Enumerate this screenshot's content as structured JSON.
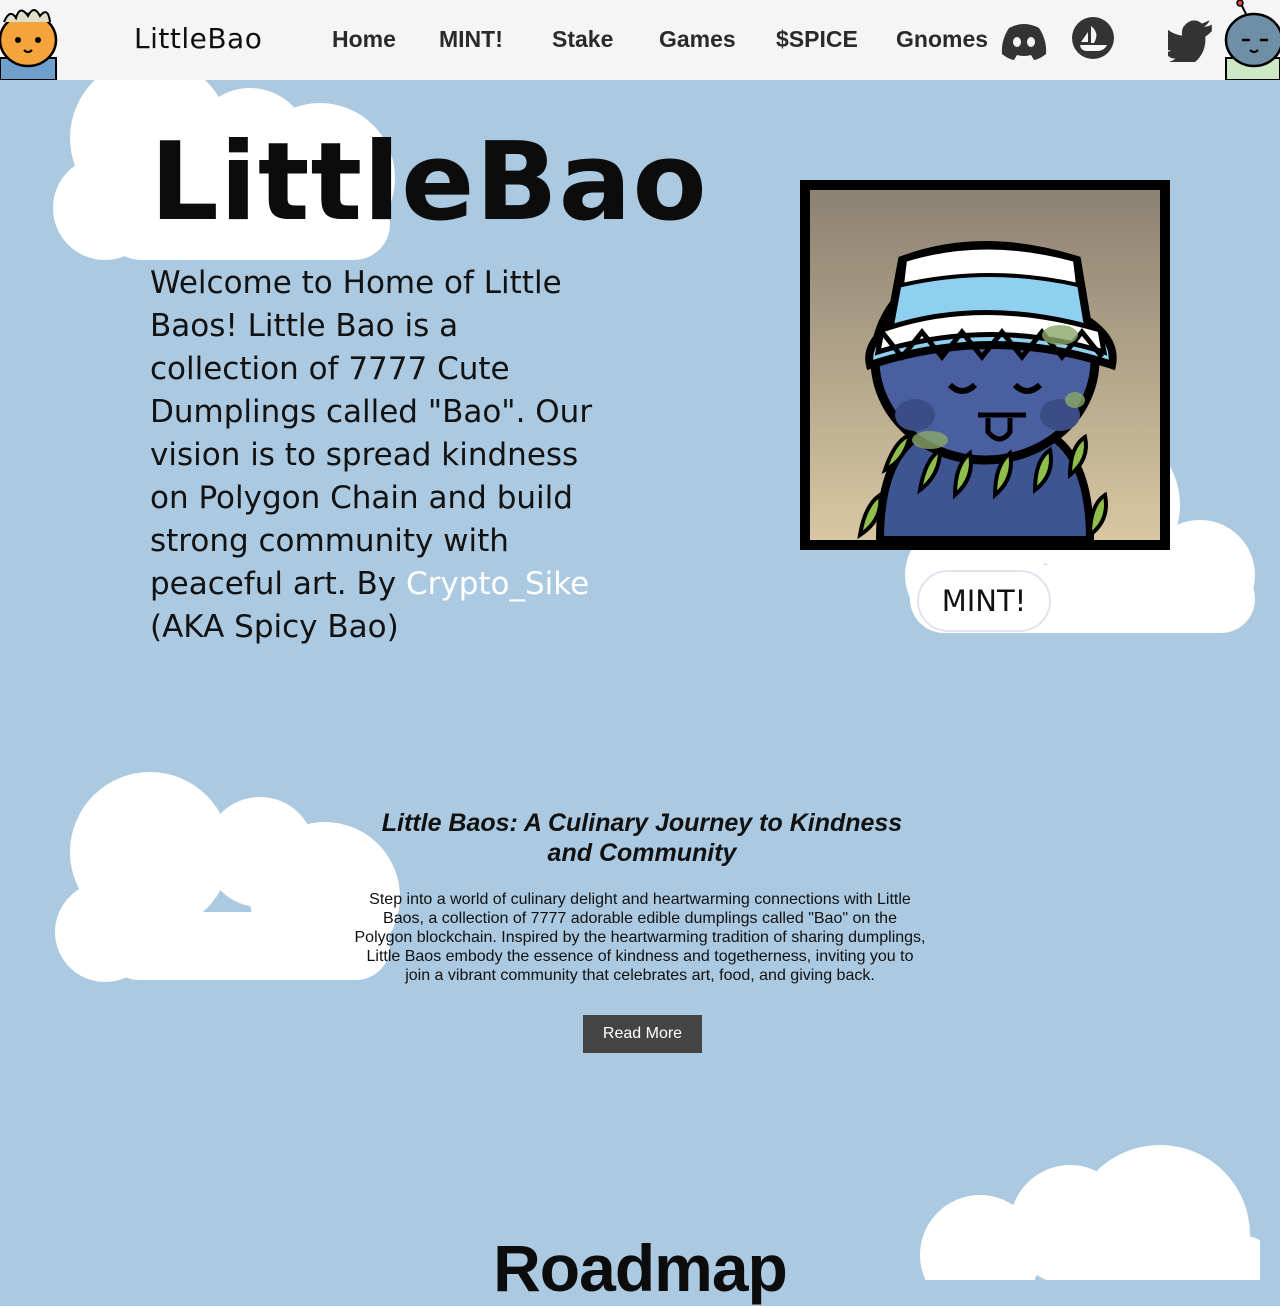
{
  "nav": {
    "brand": "LittleBao",
    "links": [
      "Home",
      "MINT!",
      "Stake",
      "Games",
      "$SPICE",
      "Gnomes"
    ],
    "social_icons": [
      "discord-icon",
      "opensea-icon",
      "twitter-icon"
    ]
  },
  "hero": {
    "title": "LittleBao",
    "text_before_link": "Welcome to Home of Little Baos! Little Bao is a collection of 7777 Cute Dumplings called \"Bao\". Our vision is to spread kindness on Polygon Chain and build strong community with peaceful art. By ",
    "link_text": "Crypto_Sike",
    "text_after_link": " (AKA Spicy Bao)",
    "mint_label": "MINT!"
  },
  "about": {
    "title": "Little Baos: A Culinary Journey to Kindness and Community",
    "text": "Step into a world of culinary delight and heartwarming connections with Little Baos, a collection of 7777 adorable edible dumplings called \"Bao\" on the Polygon blockchain. Inspired by the heartwarming tradition of sharing dumplings, Little Baos embody the essence of kindness and togetherness, inviting you to join a vibrant community that celebrates art, food, and giving back.",
    "button_label": "Read More"
  },
  "roadmap": {
    "title": "Roadmap"
  },
  "colors": {
    "background": "#abc9e0",
    "nav_background": "#f5f5f5",
    "cloud": "#ffffff",
    "button_dark": "#444444",
    "link": "#ffffff"
  }
}
